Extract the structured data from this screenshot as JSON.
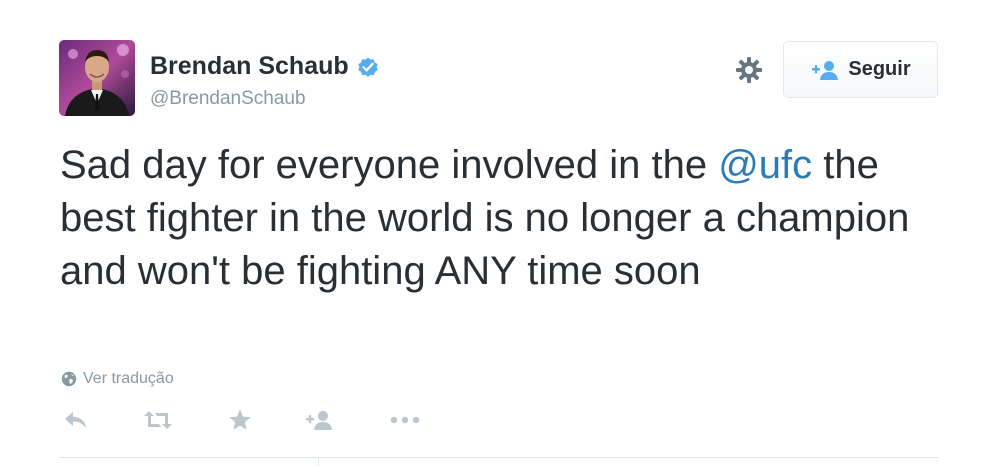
{
  "user": {
    "name": "Brendan Schaub",
    "handle": "@BrendanSchaub",
    "verified": true
  },
  "follow": {
    "label": "Seguir"
  },
  "tweet": {
    "text_before": "Sad day for everyone involved in the ",
    "mention": "@ufc",
    "text_after": " the best fighter in the world is no longer a champion and won't be fighting ANY time soon"
  },
  "translate": {
    "label": "Ver tradução"
  },
  "actions": {
    "icons": [
      "reply-icon",
      "retweet-icon",
      "favorite-icon",
      "follow-icon",
      "more-icon"
    ]
  },
  "colors": {
    "text": "#292f33",
    "muted": "#8899a6",
    "link": "#2b7bb9",
    "verified": "#55acee",
    "border": "#e1e8ed"
  }
}
